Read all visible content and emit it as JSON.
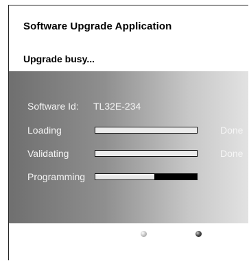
{
  "header": {
    "title": "Software Upgrade Application",
    "subtitle": "Upgrade busy..."
  },
  "panel": {
    "software_id_label": "Software Id:",
    "software_id_value": "TL32E-234",
    "rows": [
      {
        "label": "Loading",
        "status": "Done",
        "progress": 1.0
      },
      {
        "label": "Validating",
        "status": "Done",
        "progress": 1.0
      },
      {
        "label": "Programming",
        "status": "",
        "progress": 0.58
      }
    ]
  },
  "indicators": {
    "dots": [
      "light",
      "dark"
    ]
  },
  "colors": {
    "panel_gradient_start": "#6f6f6f",
    "panel_gradient_end": "#e2e2e2",
    "text_on_panel": "#f4f4f4"
  }
}
